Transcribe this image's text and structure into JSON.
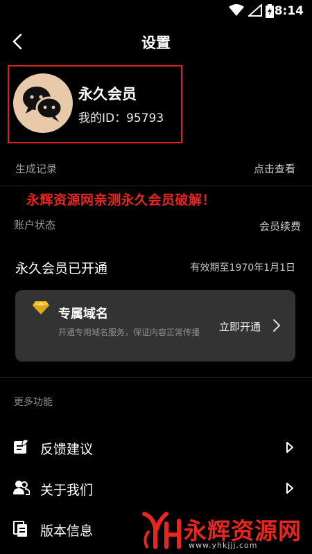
{
  "status_bar": {
    "time": "8:14",
    "icons": [
      "wifi-icon",
      "signal-icon",
      "battery-icon"
    ]
  },
  "header": {
    "title": "设置",
    "back_icon": "chevron-left-icon"
  },
  "profile": {
    "name": "永久会员",
    "id_label": "我的ID：95793",
    "avatar_icon": "wechat-icon"
  },
  "records": {
    "label": "生成记录",
    "action": "点击查看"
  },
  "watermark_banner": "永辉资源网亲测永久会员破解！",
  "account": {
    "label": "账户状态",
    "action": "会员续费"
  },
  "membership": {
    "status": "永久会员已开通",
    "expiry": "有效期至1970年1月1日"
  },
  "domain_card": {
    "title": "专属域名",
    "description": "开通专用域名服务，保证内容正常传播",
    "action": "立即开通",
    "icon": "diamond-icon"
  },
  "more": {
    "title": "更多功能",
    "items": [
      {
        "label": "反馈建议",
        "icon": "edit-icon"
      },
      {
        "label": "关于我们",
        "icon": "users-icon"
      },
      {
        "label": "版本信息",
        "icon": "document-icon"
      }
    ]
  },
  "logo": {
    "text": "永辉资源网",
    "url": "www.yhkjjj.com"
  },
  "colors": {
    "background": "#000000",
    "accent_red": "#e8251f",
    "card": "#333333"
  }
}
